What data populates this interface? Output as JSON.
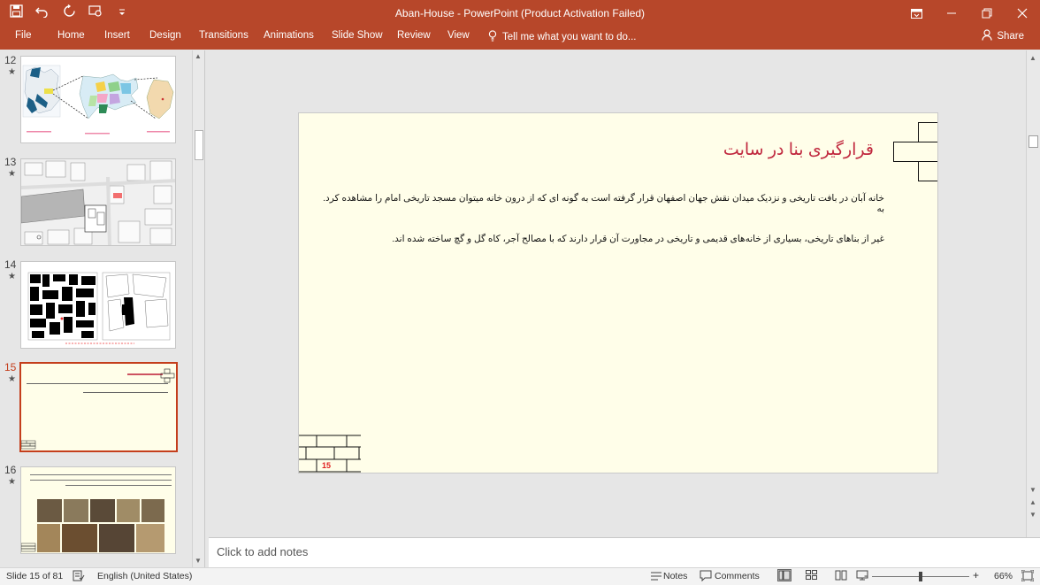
{
  "window": {
    "title": "Aban-House  -  PowerPoint (Product Activation Failed)",
    "controls": [
      "ribbon-display-icon",
      "minimize-icon",
      "restore-icon",
      "close-icon"
    ]
  },
  "quick_access": [
    "save-icon",
    "undo-icon",
    "redo-icon",
    "present-icon",
    "customize-icon"
  ],
  "ribbon": {
    "tabs": [
      "File",
      "Home",
      "Insert",
      "Design",
      "Transitions",
      "Animations",
      "Slide Show",
      "Review",
      "View"
    ],
    "tell_me": "Tell me what you want to do...",
    "share": "Share"
  },
  "thumbnails": [
    {
      "number": "12",
      "star": "★"
    },
    {
      "number": "13",
      "star": "★"
    },
    {
      "number": "14",
      "star": "★"
    },
    {
      "number": "15",
      "star": "★"
    },
    {
      "number": "16",
      "star": "★"
    }
  ],
  "slide": {
    "title": "قرارگیری بنا در سایت",
    "paragraph1": "خانه آبان در بافت تاریخی و نزدیک میدان نقش جهان اصفهان قرار گرفته است به گونه ای که از درون خانه میتوان مسجد تاریخی امام را مشاهده کرد. به",
    "paragraph2": "غیر از بناهای تاریخی، بسیاری از خانه‌های قدیمی و تاریخی در مجاورت آن قرار دارند که با مصالح آجر، کاه گل و گچ ساخته شده اند.",
    "number": "15"
  },
  "notes": {
    "placeholder": "Click to add notes"
  },
  "status": {
    "slide_count": "Slide 15 of 81",
    "language": "English (United States)",
    "notes_label": "Notes",
    "comments_label": "Comments",
    "zoom": "66%",
    "zoom_minus": "-",
    "zoom_plus": "+"
  },
  "colors": {
    "accent": "#b7472a",
    "slide_bg": "#fffee9",
    "title_red": "#c0283e",
    "selected_border": "#c43e1c"
  }
}
